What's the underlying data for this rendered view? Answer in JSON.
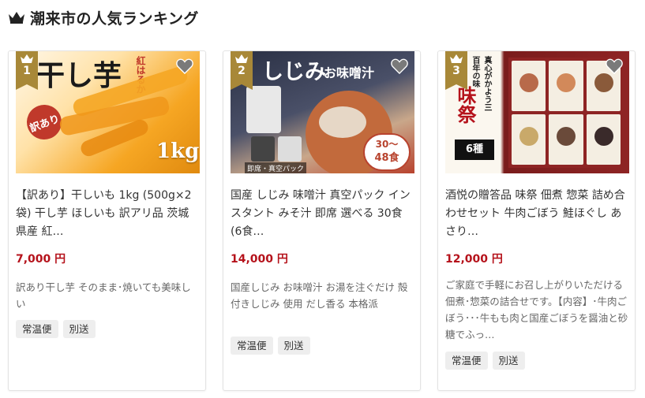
{
  "header": {
    "title": "潮来市の人気ランキング",
    "icon": "crown-icon"
  },
  "colors": {
    "price": "#b5121b",
    "badge": "#a88838"
  },
  "cards": [
    {
      "rank": "1",
      "image_text": {
        "main": "干し芋",
        "sub": "紅はるか",
        "tag": "訳あり",
        "weight": "1kg"
      },
      "title": "【訳あり】干しいも 1kg (500g×2袋) 干し芋 ほしいも 訳アリ品 茨城県産 紅…",
      "price": "7,000 円",
      "description": "訳あり干し芋 そのまま･焼いても美味しい",
      "tags": [
        "常温便",
        "別送"
      ]
    },
    {
      "rank": "2",
      "image_text": {
        "main": "しじみ",
        "sub": "お味噌汁",
        "pack": "即席・真空パック",
        "count1": "30〜",
        "count2": "48食"
      },
      "title": "国産 しじみ 味噌汁 真空パック インスタント みそ汁 即席 選べる 30食 (6食…",
      "price": "14,000 円",
      "description": "国産しじみ お味噌汁 お湯を注ぐだけ 殻付きしじみ 使用 だし香る 本格派",
      "tags": [
        "常温便",
        "別送"
      ]
    },
    {
      "rank": "3",
      "image_text": {
        "main": "味祭",
        "sub": "真心がかよう三百年の味",
        "count": "6種"
      },
      "title": "酒悦の贈答品 味祭 佃煮 惣菜 詰め合わせセット 牛肉ごぼう 鮭ほぐし あさり…",
      "price": "12,000 円",
      "description": "ご家庭で手軽にお召し上がりいただける佃煮･惣菜の詰合せです。【内容】･牛肉ごぼう･･･牛もも肉と国産ごぼうを醤油と砂糖でふっ…",
      "tags": [
        "常温便",
        "別送"
      ]
    }
  ]
}
